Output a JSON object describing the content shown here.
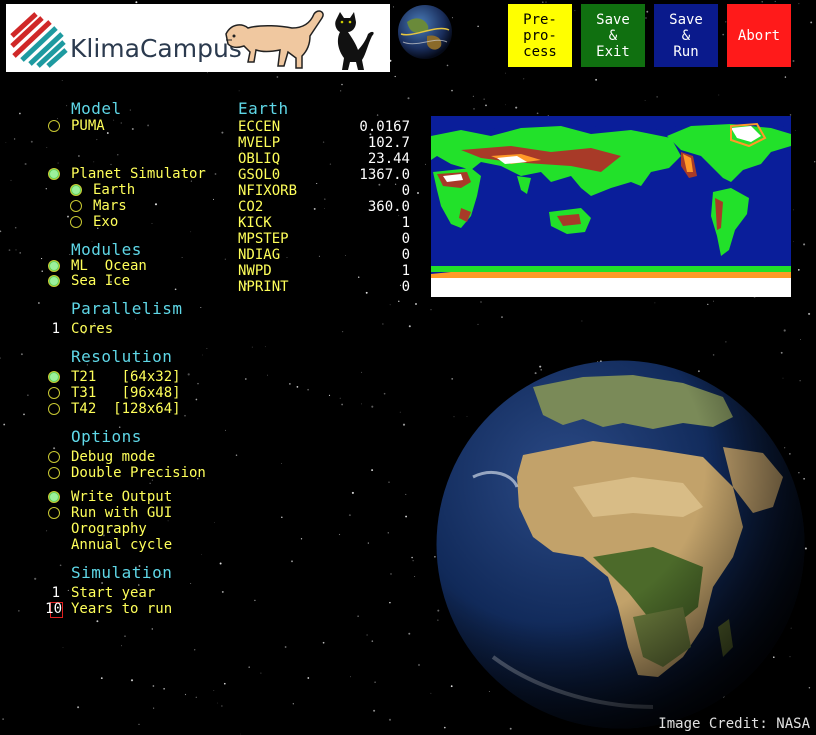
{
  "header": {
    "logo_text": "KlimaCampus",
    "buttons": {
      "preprocess": "Pre-\npro-\ncess",
      "save_exit": "Save\n&\nExit",
      "save_run": "Save\n&\nRun",
      "abort": "Abort"
    }
  },
  "colors": {
    "preprocess": "#ffff00",
    "save_exit": "#107010",
    "save_run": "#0a1a8c",
    "abort": "#ff1a1a",
    "heading": "#5fd7e7",
    "label": "#ffff5a"
  },
  "model": {
    "heading": "Model",
    "puma": "PUMA",
    "plasim": "Planet Simulator",
    "earth": "Earth",
    "mars": "Mars",
    "exo": "Exo"
  },
  "modules": {
    "heading": "Modules",
    "ml_ocean": "ML  Ocean",
    "sea_ice": "Sea Ice"
  },
  "parallelism": {
    "heading": "Parallelism",
    "cores_value": "1",
    "cores_label": "Cores"
  },
  "resolution": {
    "heading": "Resolution",
    "t21": "T21   [64x32]",
    "t31": "T31   [96x48]",
    "t42": "T42  [128x64]"
  },
  "options": {
    "heading": "Options",
    "debug": "Debug mode",
    "double": "Double Precision",
    "write_output": "Write Output",
    "run_gui": "Run with GUI",
    "orography": "Orography",
    "annual": "Annual cycle"
  },
  "simulation": {
    "heading": "Simulation",
    "start_value": "1",
    "start_label": "Start year",
    "years_value": "10",
    "years_label": "Years to run"
  },
  "earth_params": {
    "heading": "Earth",
    "rows": [
      {
        "name": "ECCEN",
        "value": "0.0167"
      },
      {
        "name": "MVELP",
        "value": "102.7"
      },
      {
        "name": "OBLIQ",
        "value": "23.44"
      },
      {
        "name": "GSOL0",
        "value": "1367.0"
      },
      {
        "name": "NFIXORB",
        "value": "0"
      },
      {
        "name": "CO2",
        "value": "360.0"
      },
      {
        "name": "KICK",
        "value": "1"
      },
      {
        "name": "MPSTEP",
        "value": "0"
      },
      {
        "name": "NDIAG",
        "value": "0"
      },
      {
        "name": "NWPD",
        "value": "1"
      },
      {
        "name": "NPRINT",
        "value": "0"
      }
    ]
  },
  "credit": "Image Credit: NASA",
  "icons": [
    "klimacampus-logo-icon",
    "puma-icon",
    "cat-icon",
    "globe-icon",
    "world-map",
    "earth-globe"
  ]
}
